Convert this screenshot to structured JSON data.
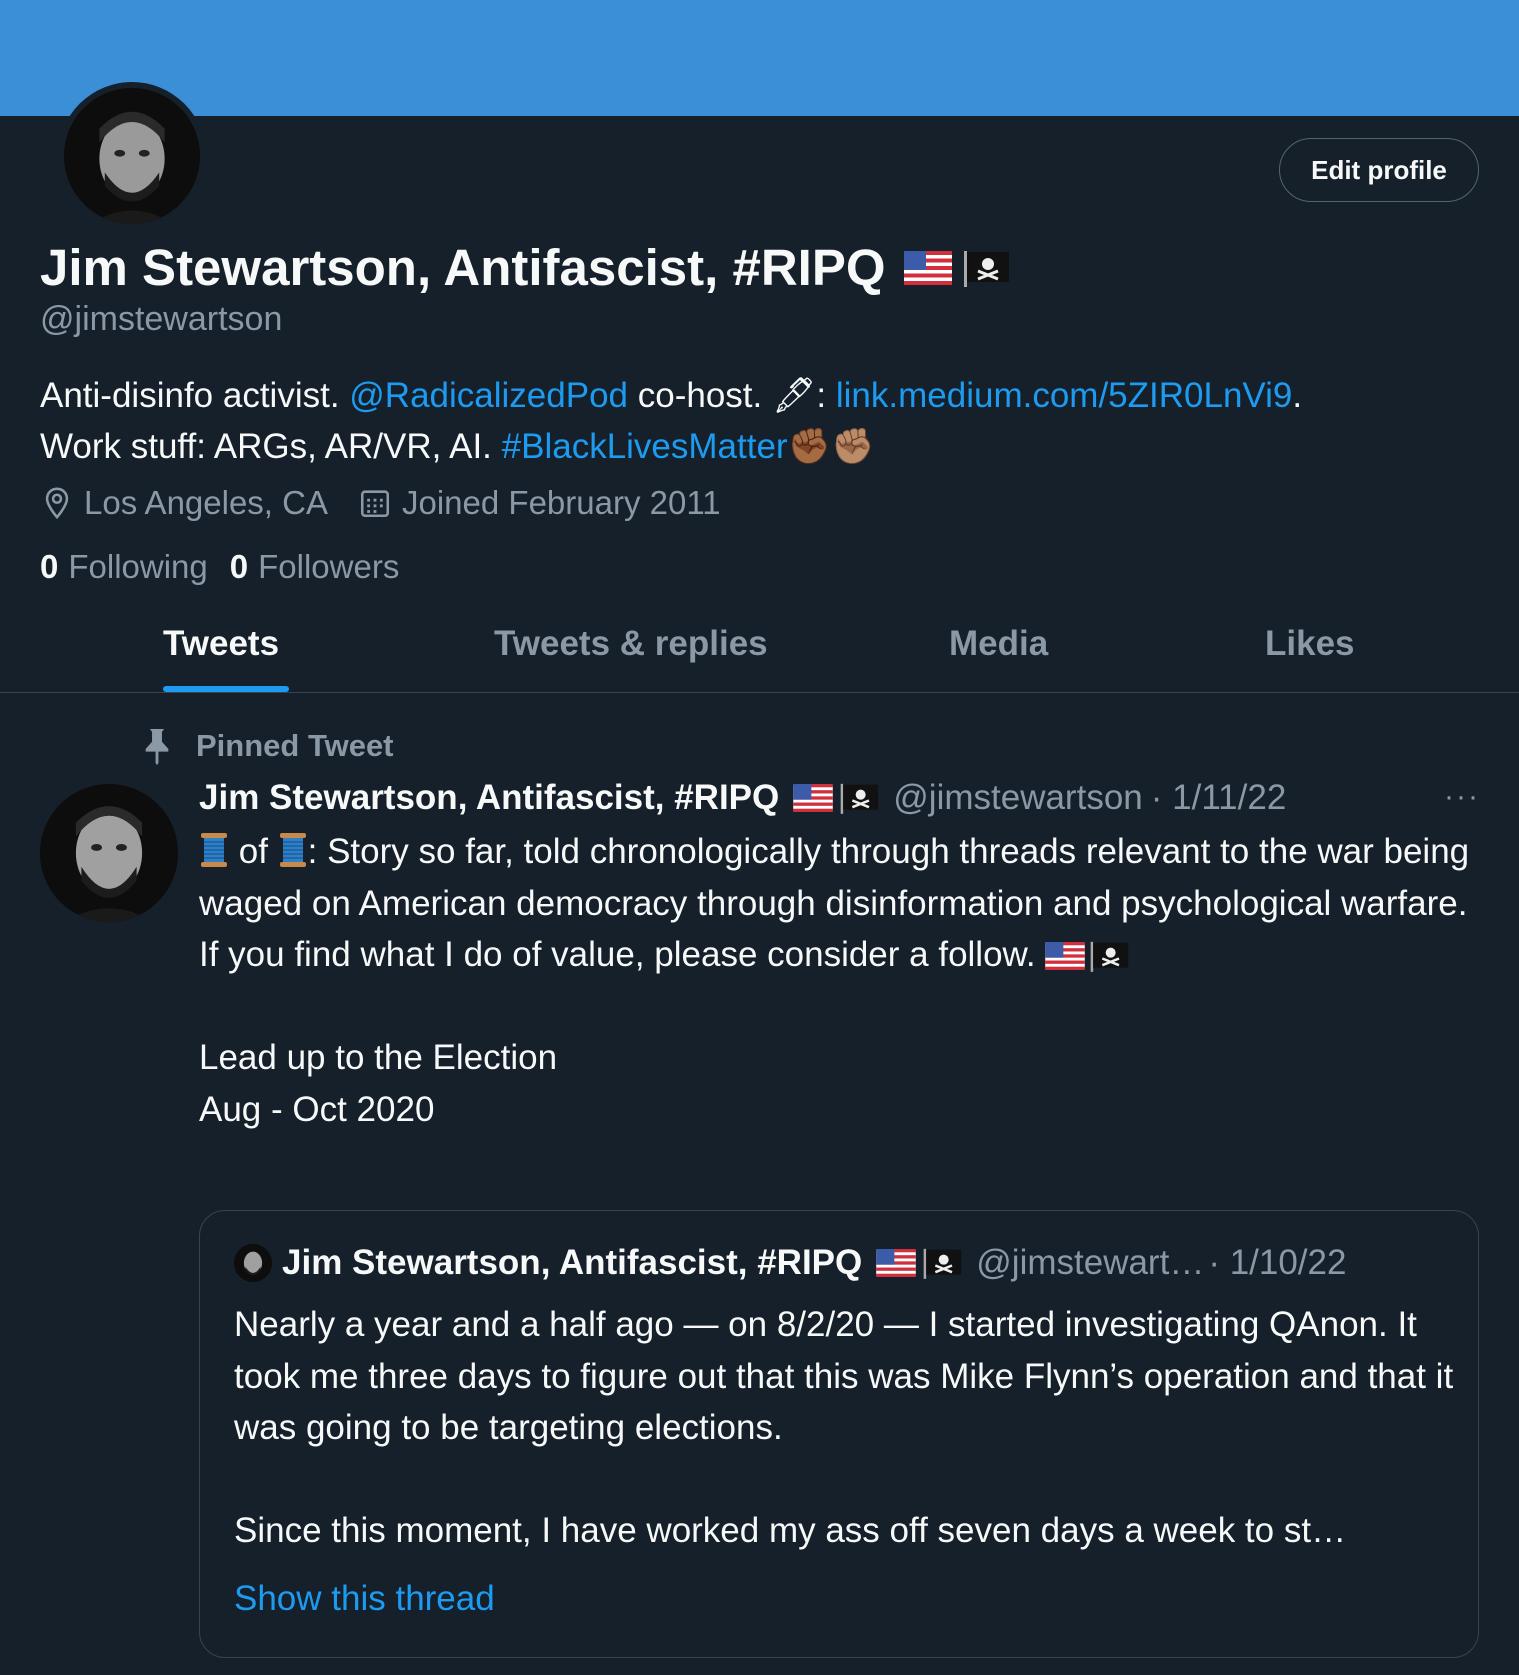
{
  "profile": {
    "name": "Jim Stewartson, Antifascist, #RIPQ",
    "handle": "@jimstewartson",
    "edit_button": "Edit profile",
    "bio": {
      "part1": "Anti-disinfo activist. ",
      "mention": "@RadicalizedPod",
      "part2": " co-host. ",
      "pen_emoji": "🖋",
      "part3": ": ",
      "link": "link.medium.com/5ZIR0LnVi9",
      "part4": ".",
      "line2": "Work stuff: ARGs, AR/VR, AI. ",
      "hashtag": "#BlackLivesMatter",
      "fists_emoji": "✊🏾✊🏽"
    },
    "location": "Los Angeles, CA",
    "joined": "Joined February 2011",
    "following_count": "0",
    "following_label": "Following",
    "followers_count": "0",
    "followers_label": "Followers"
  },
  "tabs": [
    "Tweets",
    "Tweets & replies",
    "Media",
    "Likes"
  ],
  "pinned_label": "Pinned Tweet",
  "tweet": {
    "name": "Jim Stewartson, Antifascist, #RIPQ",
    "handle": "@jimstewartson",
    "date": "· 1/11/22",
    "more": "···",
    "of": " of ",
    "text_rest": ": Story so far, told chronologically through threads relevant to the war being waged on American democracy through disinformation and psychological warfare.\nIf you find what I do of value, please consider a follow. ",
    "text_end": "\n\nLead up to the Election\nAug - Oct 2020"
  },
  "quoted": {
    "name": "Jim Stewartson, Antifascist, #RIPQ",
    "handle": "@jimstewart…",
    "date": " · 1/10/22",
    "text": "Nearly a year and a half ago — on 8/2/20 — I started investigating QAnon. It took me three days to figure out that this was Mike Flynn’s operation and that it was going to be targeting elections.\n\nSince this moment, I have worked my ass off seven days a week to st…",
    "show_thread": "Show this thread"
  },
  "colors": {
    "background": "#15202b",
    "banner": "#3a8fd6",
    "accent": "#1d9bf0",
    "muted": "#8b98a5"
  }
}
